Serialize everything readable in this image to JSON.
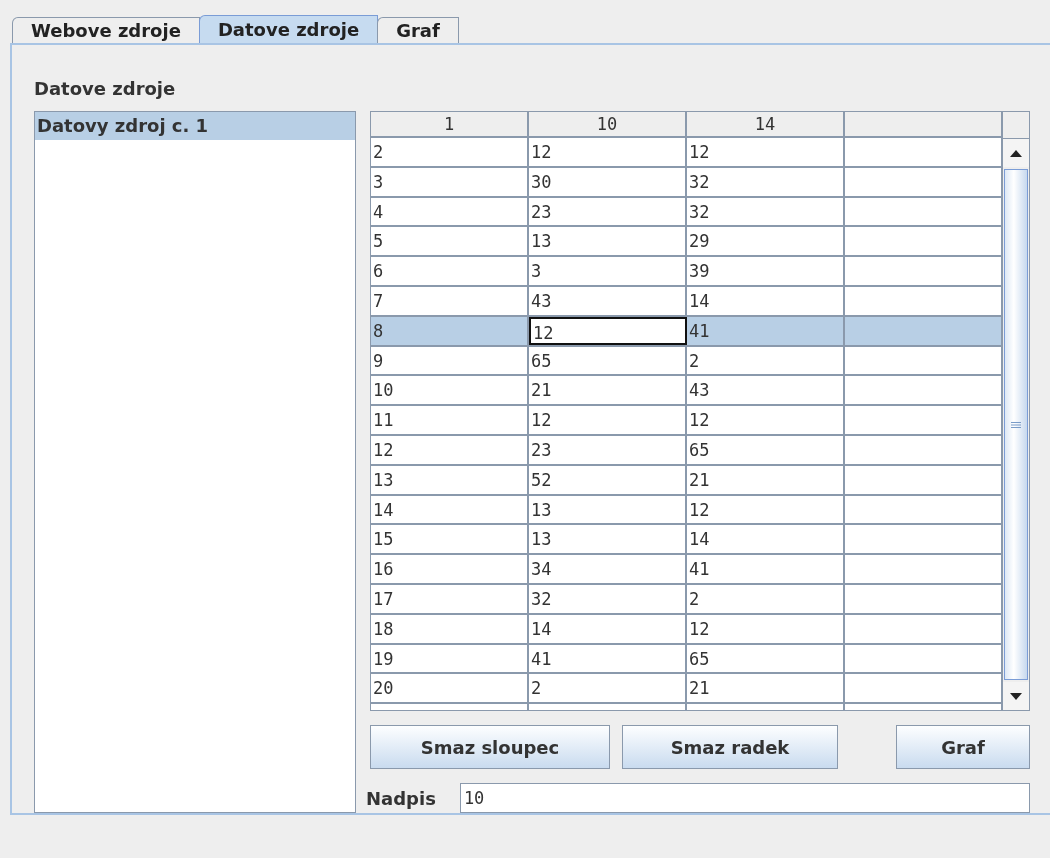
{
  "tabs": [
    {
      "label": "Webove zdroje",
      "selected": false
    },
    {
      "label": "Datove zdroje",
      "selected": true
    },
    {
      "label": "Graf",
      "selected": false
    }
  ],
  "section_title": "Datove zdroje",
  "sources": [
    {
      "label": "Datovy zdroj c. 1",
      "selected": true
    }
  ],
  "table": {
    "columns": [
      "1",
      "10",
      "14"
    ],
    "rows": [
      {
        "cells": [
          {
            "text": "2",
            "editing": false
          },
          {
            "text": "12",
            "editing": false
          },
          {
            "text": "12",
            "editing": false
          }
        ],
        "selected": false
      },
      {
        "cells": [
          {
            "text": "3",
            "editing": false
          },
          {
            "text": "30",
            "editing": false
          },
          {
            "text": "32",
            "editing": false
          }
        ],
        "selected": false
      },
      {
        "cells": [
          {
            "text": "4",
            "editing": false
          },
          {
            "text": "23",
            "editing": false
          },
          {
            "text": "32",
            "editing": false
          }
        ],
        "selected": false
      },
      {
        "cells": [
          {
            "text": "5",
            "editing": false
          },
          {
            "text": "13",
            "editing": false
          },
          {
            "text": "29",
            "editing": false
          }
        ],
        "selected": false
      },
      {
        "cells": [
          {
            "text": "6",
            "editing": false
          },
          {
            "text": "3",
            "editing": false
          },
          {
            "text": "39",
            "editing": false
          }
        ],
        "selected": false
      },
      {
        "cells": [
          {
            "text": "7",
            "editing": false
          },
          {
            "text": "43",
            "editing": false
          },
          {
            "text": "14",
            "editing": false
          }
        ],
        "selected": false
      },
      {
        "cells": [
          {
            "text": "8",
            "editing": false
          },
          {
            "text": "12",
            "editing": true
          },
          {
            "text": "41",
            "editing": false
          }
        ],
        "selected": true
      },
      {
        "cells": [
          {
            "text": "9",
            "editing": false
          },
          {
            "text": "65",
            "editing": false
          },
          {
            "text": "2",
            "editing": false
          }
        ],
        "selected": false
      },
      {
        "cells": [
          {
            "text": "10",
            "editing": false
          },
          {
            "text": "21",
            "editing": false
          },
          {
            "text": "43",
            "editing": false
          }
        ],
        "selected": false
      },
      {
        "cells": [
          {
            "text": "11",
            "editing": false
          },
          {
            "text": "12",
            "editing": false
          },
          {
            "text": "12",
            "editing": false
          }
        ],
        "selected": false
      },
      {
        "cells": [
          {
            "text": "12",
            "editing": false
          },
          {
            "text": "23",
            "editing": false
          },
          {
            "text": "65",
            "editing": false
          }
        ],
        "selected": false
      },
      {
        "cells": [
          {
            "text": "13",
            "editing": false
          },
          {
            "text": "52",
            "editing": false
          },
          {
            "text": "21",
            "editing": false
          }
        ],
        "selected": false
      },
      {
        "cells": [
          {
            "text": "14",
            "editing": false
          },
          {
            "text": "13",
            "editing": false
          },
          {
            "text": "12",
            "editing": false
          }
        ],
        "selected": false
      },
      {
        "cells": [
          {
            "text": "15",
            "editing": false
          },
          {
            "text": "13",
            "editing": false
          },
          {
            "text": "14",
            "editing": false
          }
        ],
        "selected": false
      },
      {
        "cells": [
          {
            "text": "16",
            "editing": false
          },
          {
            "text": "34",
            "editing": false
          },
          {
            "text": "41",
            "editing": false
          }
        ],
        "selected": false
      },
      {
        "cells": [
          {
            "text": "17",
            "editing": false
          },
          {
            "text": "32",
            "editing": false
          },
          {
            "text": "2",
            "editing": false
          }
        ],
        "selected": false
      },
      {
        "cells": [
          {
            "text": "18",
            "editing": false
          },
          {
            "text": "14",
            "editing": false
          },
          {
            "text": "12",
            "editing": false
          }
        ],
        "selected": false
      },
      {
        "cells": [
          {
            "text": "19",
            "editing": false
          },
          {
            "text": "41",
            "editing": false
          },
          {
            "text": "65",
            "editing": false
          }
        ],
        "selected": false
      },
      {
        "cells": [
          {
            "text": "20",
            "editing": false
          },
          {
            "text": "2",
            "editing": false
          },
          {
            "text": "21",
            "editing": false
          }
        ],
        "selected": false
      }
    ]
  },
  "buttons": [
    "Smaz sloupec",
    "Smaz radek",
    "Graf"
  ],
  "caption": {
    "label": "Nadpis",
    "value": "10"
  }
}
